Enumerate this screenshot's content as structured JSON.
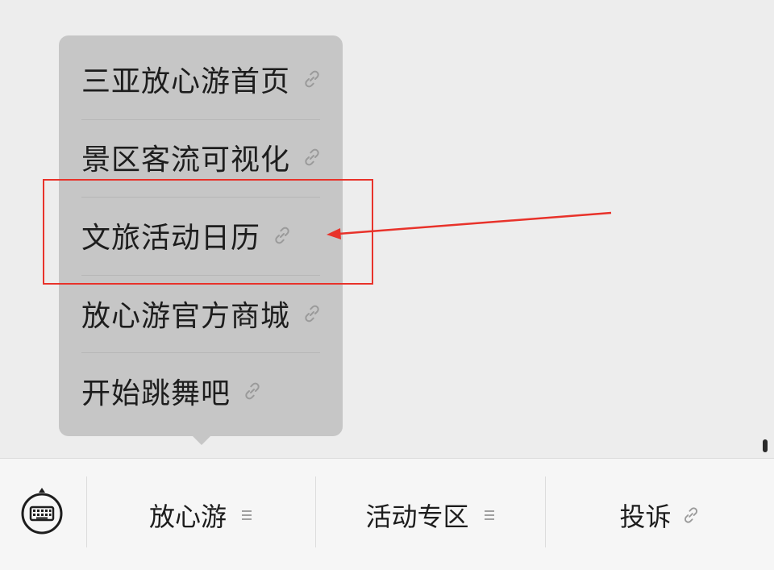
{
  "popup_menu": {
    "items": [
      {
        "label": "三亚放心游首页",
        "icon": "link-icon"
      },
      {
        "label": "景区客流可视化",
        "icon": "link-icon"
      },
      {
        "label": "文旅活动日历",
        "icon": "link-icon"
      },
      {
        "label": "放心游官方商城",
        "icon": "link-icon"
      },
      {
        "label": "开始跳舞吧",
        "icon": "link-icon"
      }
    ]
  },
  "bottom_bar": {
    "keyboard_icon": "keyboard-icon",
    "tabs": [
      {
        "label": "放心游",
        "icon": "menu-lines-icon"
      },
      {
        "label": "活动专区",
        "icon": "menu-lines-icon"
      },
      {
        "label": "投诉",
        "icon": "link-icon"
      }
    ]
  },
  "annotation": {
    "highlight_color": "#e8322a",
    "highlighted_item": "文旅活动日历"
  }
}
